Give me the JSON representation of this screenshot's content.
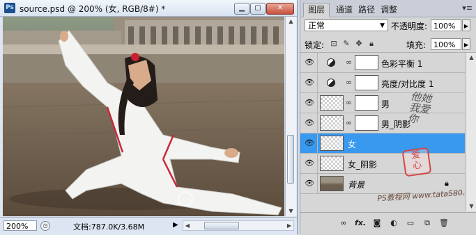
{
  "document": {
    "title": "source.psd @ 200% (女, RGB/8#) *",
    "app_icon": "Ps",
    "zoom": "200%",
    "doc_info": "文档:787.0K/3.68M",
    "window_buttons": [
      "minimize",
      "maximize",
      "close"
    ]
  },
  "panel": {
    "tabs": [
      {
        "label": "图层",
        "active": true
      },
      {
        "label": "通道",
        "active": false
      },
      {
        "label": "路径",
        "active": false
      },
      {
        "label": "调整",
        "active": false
      }
    ],
    "blend_mode": "正常",
    "opacity_label": "不透明度:",
    "opacity_value": "100%",
    "lock_label": "锁定:",
    "fill_label": "填充:",
    "fill_value": "100%",
    "layers": [
      {
        "name": "色彩平衡 1",
        "type": "adjustment",
        "visible": true,
        "selected": false
      },
      {
        "name": "亮度/对比度 1",
        "type": "adjustment",
        "visible": true,
        "selected": false
      },
      {
        "name": "男",
        "type": "masked",
        "visible": true,
        "selected": false
      },
      {
        "name": "男_阴影",
        "type": "masked",
        "visible": true,
        "selected": false
      },
      {
        "name": "女",
        "type": "pixel",
        "visible": true,
        "selected": true
      },
      {
        "name": "女_阴影",
        "type": "pixel",
        "visible": true,
        "selected": false
      },
      {
        "name": "背景",
        "type": "background",
        "visible": true,
        "selected": false,
        "locked": true
      }
    ],
    "watermark_text": "PS教程网 www.tata580.com",
    "signature_text": "他她我爱你"
  },
  "colors": {
    "selected_layer": "#3899ee",
    "panel_bg": "#d6d6d6",
    "window_bg": "#dce5f1"
  }
}
